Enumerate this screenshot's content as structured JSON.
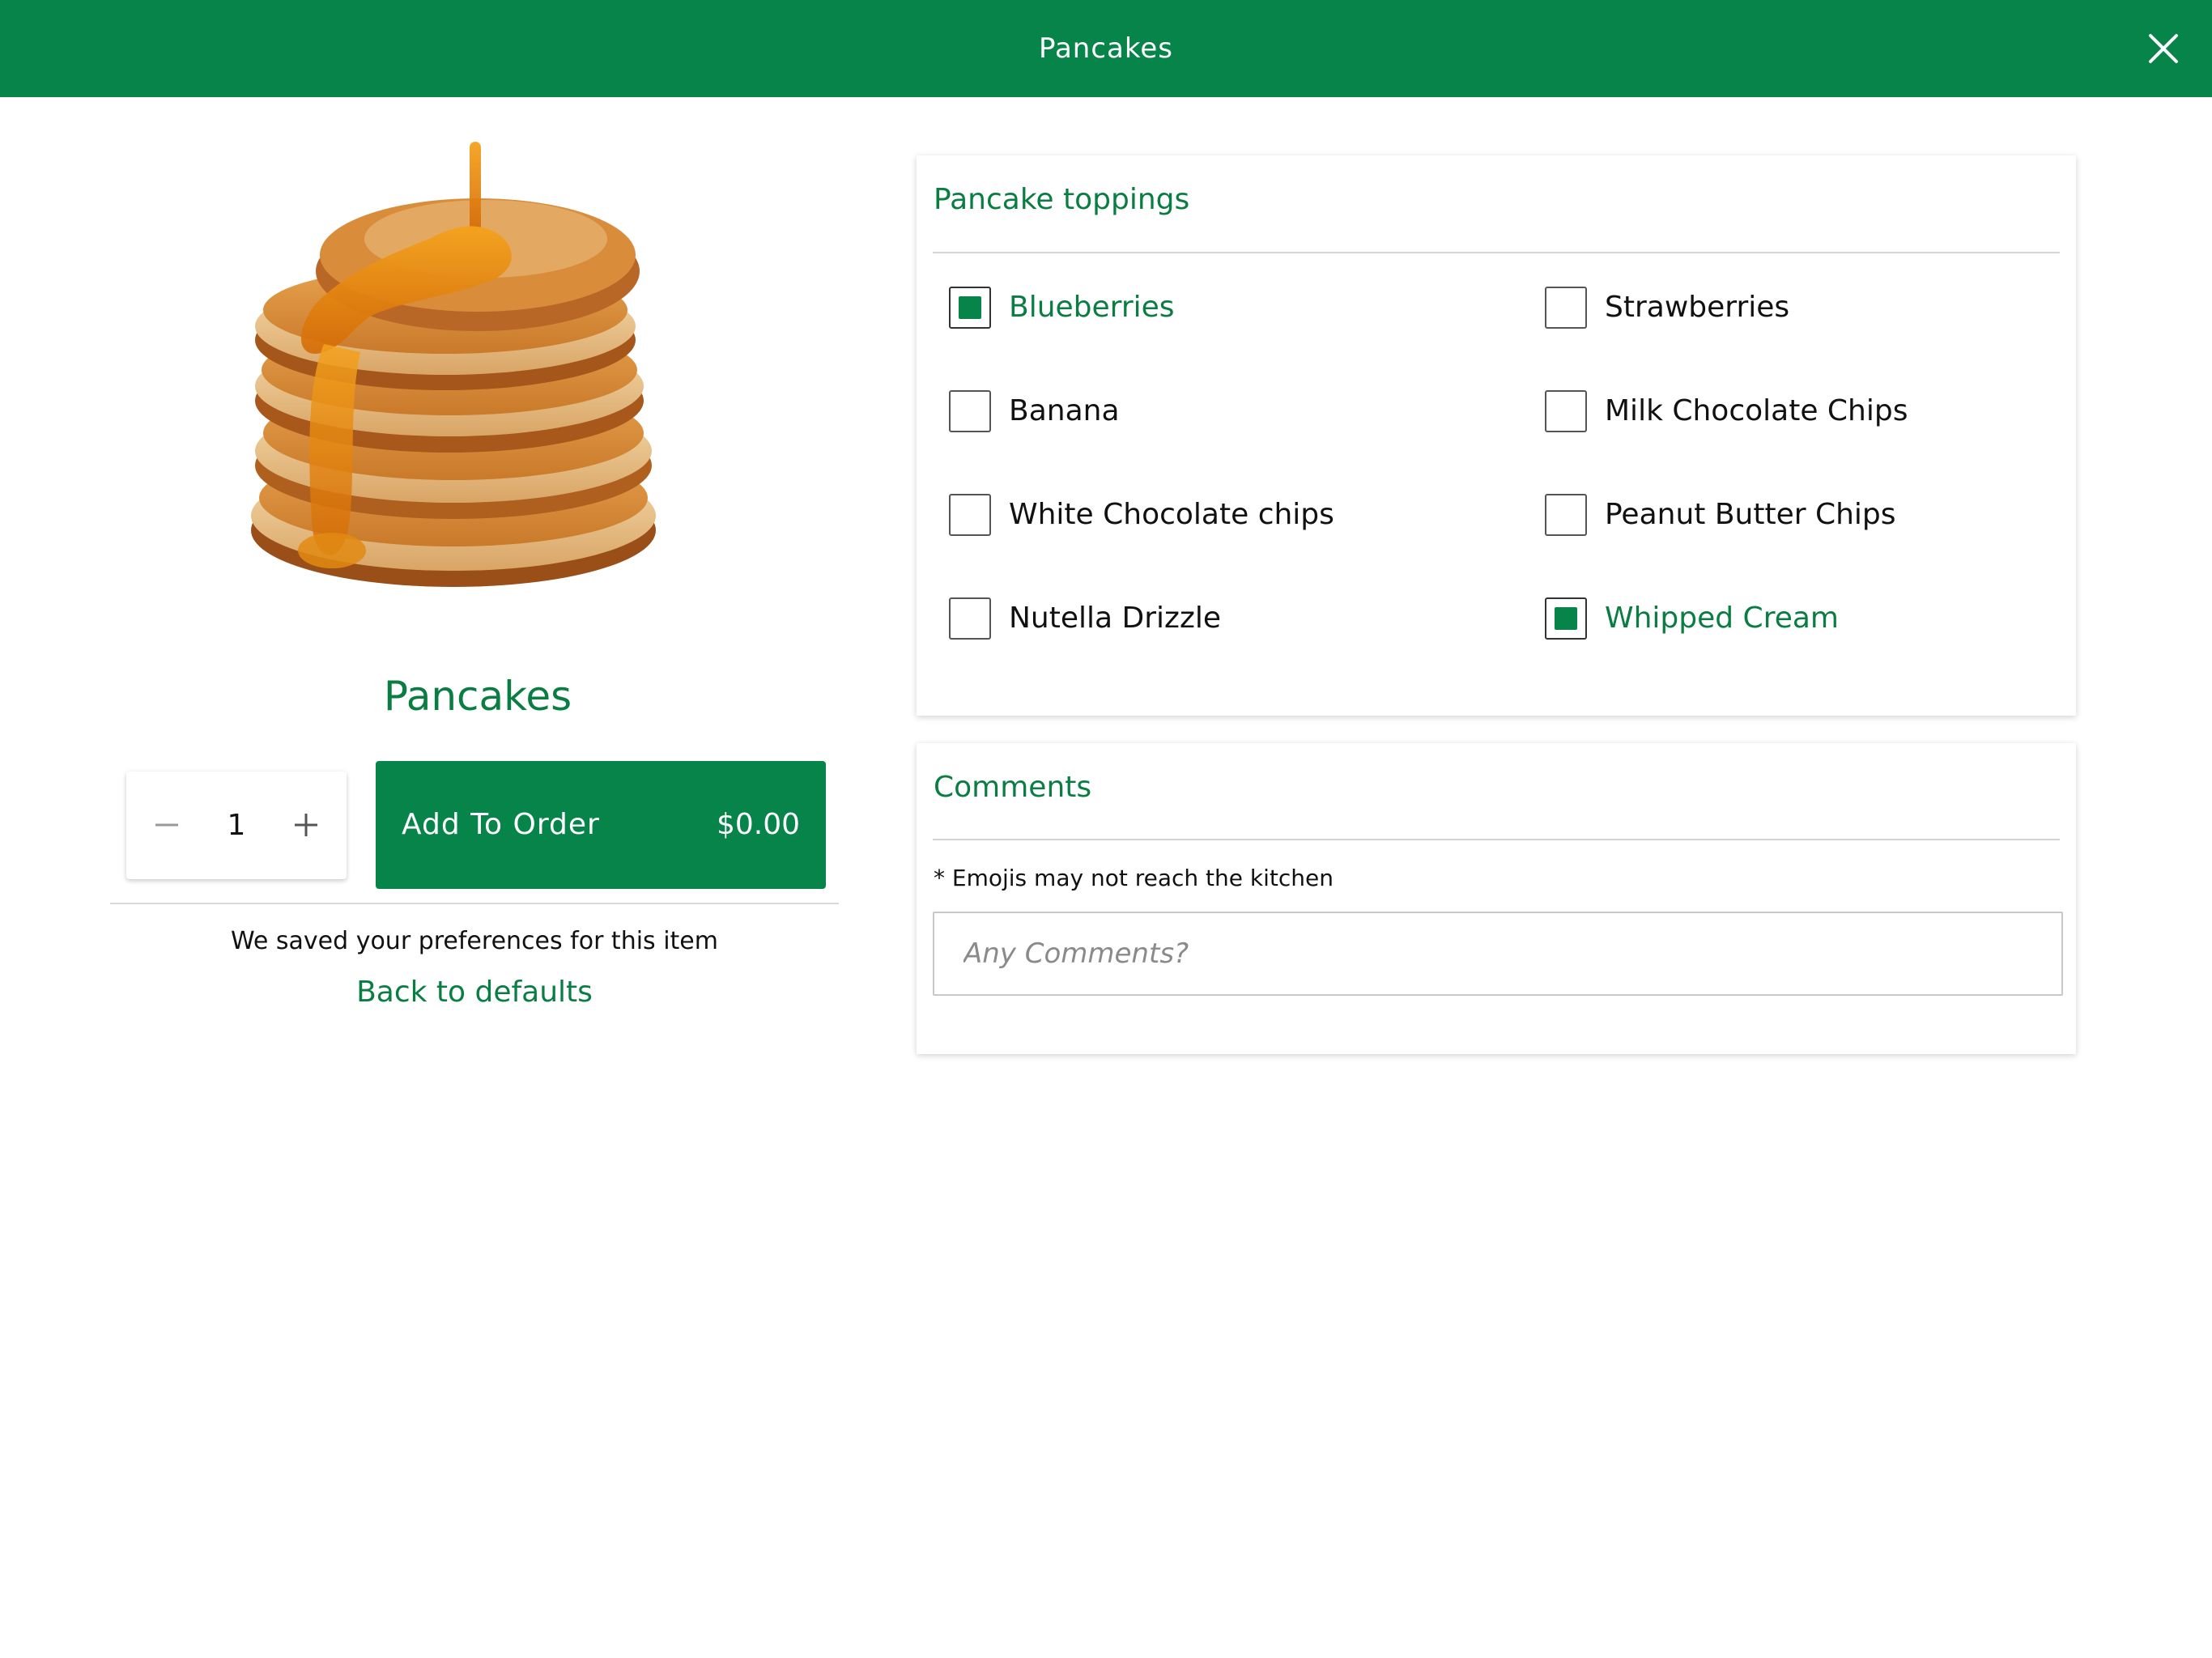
{
  "header": {
    "title": "Pancakes",
    "close_icon": "close-icon"
  },
  "product": {
    "image_icon": "pancake-stack-image",
    "name": "Pancakes",
    "quantity": "1",
    "add_label": "Add To Order",
    "price": "$0.00",
    "saved_note": "We saved your preferences for this item",
    "back_label": "Back to defaults"
  },
  "toppings": {
    "title": "Pancake toppings",
    "items": [
      {
        "label": "Blueberries",
        "checked": true
      },
      {
        "label": "Strawberries",
        "checked": false
      },
      {
        "label": "Banana",
        "checked": false
      },
      {
        "label": "Milk Chocolate Chips",
        "checked": false
      },
      {
        "label": "White Chocolate chips",
        "checked": false
      },
      {
        "label": "Peanut Butter Chips",
        "checked": false
      },
      {
        "label": "Nutella Drizzle",
        "checked": false
      },
      {
        "label": "Whipped Cream",
        "checked": true
      }
    ]
  },
  "comments": {
    "title": "Comments",
    "note": "* Emojis may not reach the kitchen",
    "placeholder": "Any Comments?",
    "value": ""
  },
  "colors": {
    "brand_green": "#07844a",
    "text_green": "#0a7d43"
  }
}
